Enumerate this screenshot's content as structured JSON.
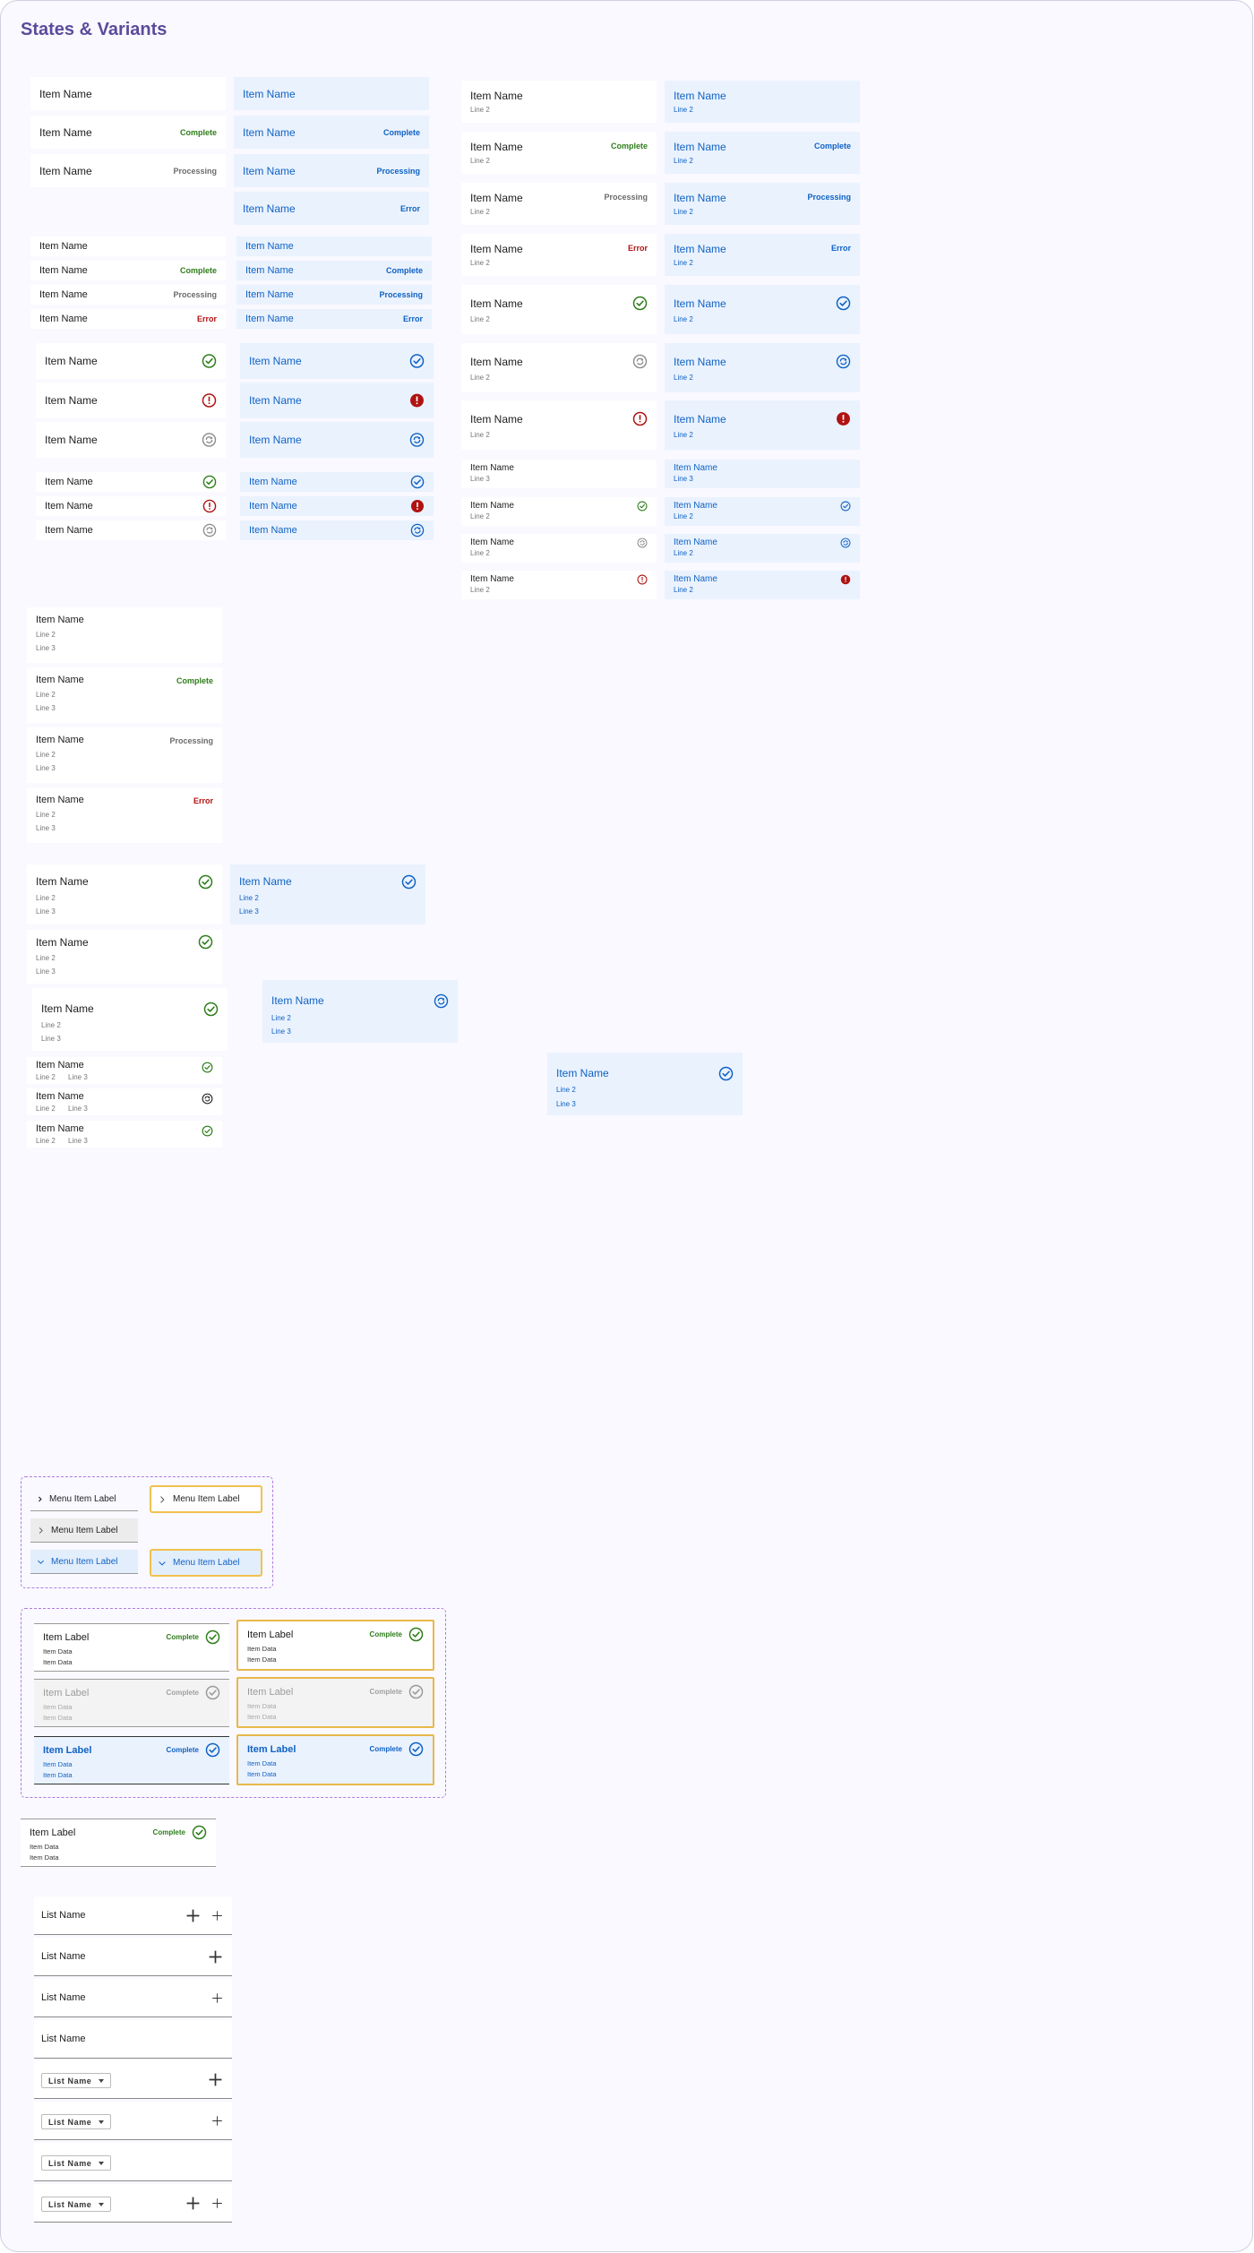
{
  "page": {
    "title": "States & Variants"
  },
  "labels": {
    "item_name": "Item Name",
    "line2": "Line 2",
    "line3": "Line 3",
    "complete": "Complete",
    "processing": "Processing",
    "error": "Error",
    "menu_item": "Menu Item Label",
    "item_label": "Item Label",
    "item_data": "Item Data",
    "list_name": "List Name"
  },
  "colors": {
    "title": "#5c4b9c",
    "selected_bg": "#eaf2fe",
    "selected_text": "#0f62c4",
    "complete": "#2e7d1a",
    "processing": "#6b6b6b",
    "error": "#b01212",
    "focus_border": "#f2c14e",
    "group_outline": "#b07be0"
  },
  "icons": [
    "check-circle-icon",
    "error-circle-icon",
    "processing-icon",
    "chevron-right-icon",
    "chevron-down-icon",
    "plus-icon",
    "caret-down-icon"
  ]
}
